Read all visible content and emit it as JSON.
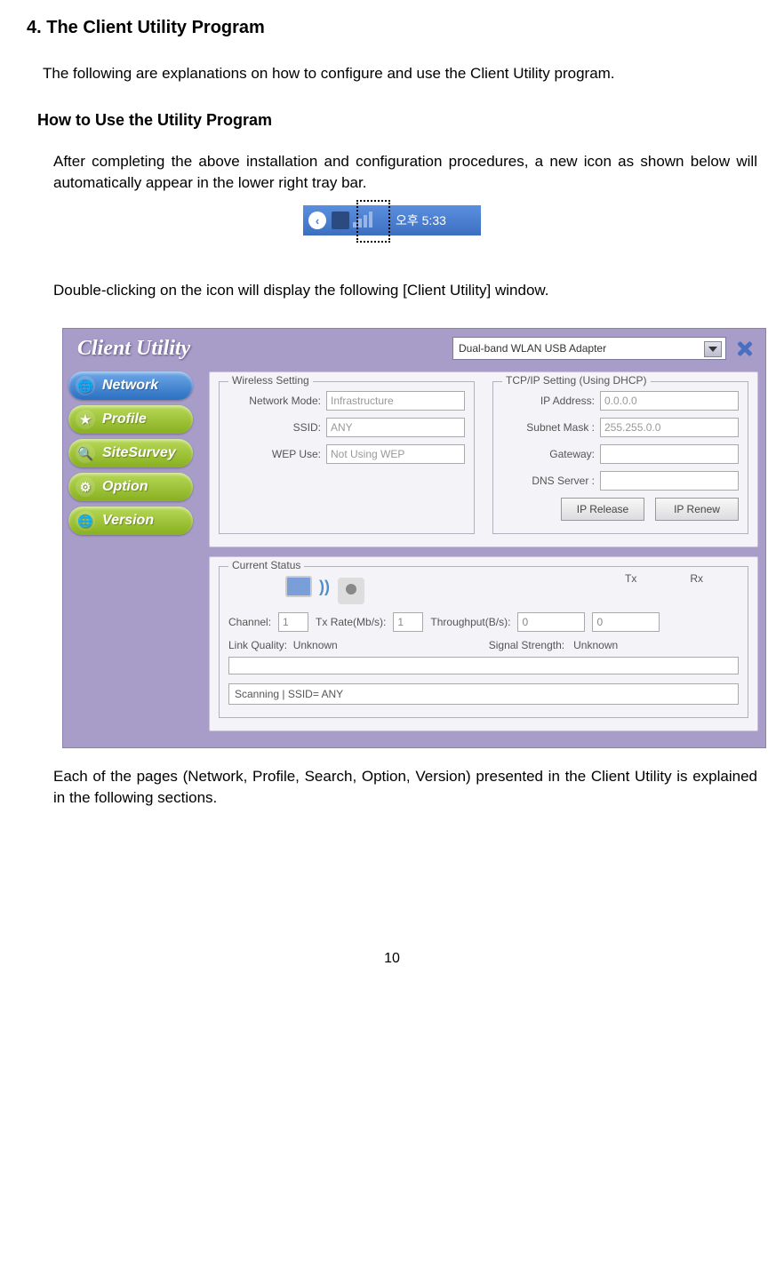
{
  "doc": {
    "heading": "4. The Client Utility Program",
    "intro": "The following are explanations on how to configure and use the Client Utility program.",
    "subheading": "How to Use the Utility Program",
    "para1": "After completing the above installation and configuration procedures, a new icon as shown below will automatically appear in the lower right tray bar.",
    "para2": "Double-clicking on the icon will display the following [Client Utility] window.",
    "para3": "Each of the pages (Network, Profile, Search, Option, Version) presented in the Client Utility is explained in the following sections.",
    "page_number": "10"
  },
  "tray": {
    "clock": "오후 5:33"
  },
  "window": {
    "title": "Client Utility",
    "adapter_selected": "Dual-band WLAN USB Adapter",
    "nav": {
      "network": "Network",
      "profile": "Profile",
      "sitesurvey": "SiteSurvey",
      "option": "Option",
      "version": "Version"
    },
    "wireless": {
      "legend": "Wireless Setting",
      "network_mode_label": "Network Mode:",
      "network_mode_value": "Infrastructure",
      "ssid_label": "SSID:",
      "ssid_value": "ANY",
      "wep_label": "WEP Use:",
      "wep_value": "Not Using WEP"
    },
    "tcpip": {
      "legend": "TCP/IP Setting  (Using DHCP)",
      "ip_label": "IP Address:",
      "ip_value": "0.0.0.0",
      "subnet_label": "Subnet Mask :",
      "subnet_value": "255.255.0.0",
      "gateway_label": "Gateway:",
      "gateway_value": "",
      "dns_label": "DNS Server :",
      "dns_value": "",
      "btn_release": "IP Release",
      "btn_renew": "IP Renew"
    },
    "status": {
      "legend": "Current Status",
      "channel_label": "Channel:",
      "channel_value": "1",
      "txrate_label": "Tx Rate(Mb/s):",
      "txrate_value": "1",
      "throughput_label": "Throughput(B/s):",
      "tx_label": "Tx",
      "rx_label": "Rx",
      "tx_value": "0",
      "rx_value": "0",
      "link_quality_label": "Link Quality:",
      "link_quality_value": "Unknown",
      "signal_strength_label": "Signal Strength:",
      "signal_strength_value": "Unknown",
      "scanning_msg": "Scanning | SSID= ANY"
    }
  }
}
